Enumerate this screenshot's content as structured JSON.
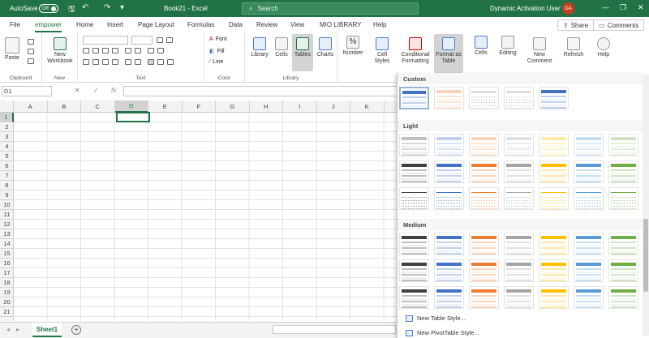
{
  "titlebar": {
    "autosave_label": "AutoSave",
    "autosave_state": "Off",
    "doc_title": "Book21 - Excel",
    "search_placeholder": "Search",
    "user_name": "Dynamic Activation User",
    "user_initials": "DA"
  },
  "tabs": [
    "File",
    "empower",
    "Home",
    "Insert",
    "Page Layout",
    "Formulas",
    "Data",
    "Review",
    "View",
    "MIO LIBRARY",
    "Help"
  ],
  "active_tab": "empower",
  "topbar": {
    "share": "Share",
    "comments": "Comments"
  },
  "ribbon": {
    "groups": {
      "clipboard": "Clipboard",
      "new": "New",
      "text": "Text",
      "color": "Color",
      "library": "Library"
    },
    "buttons": {
      "paste": "Paste",
      "new_workbook_1": "New",
      "new_workbook_2": "Workbook",
      "font": "Font",
      "fill": "Fill",
      "line": "Line",
      "library": "Library",
      "cells": "Cells",
      "tables": "Tables",
      "charts": "Charts",
      "number": "Number",
      "cell_styles_1": "Cell",
      "cell_styles_2": "Styles",
      "cond_format_1": "Conditional",
      "cond_format_2": "Formatting",
      "format_table_1": "Format as",
      "format_table_2": "Table",
      "cells2": "Cells",
      "editing": "Editing",
      "new_comment_1": "New",
      "new_comment_2": "Comment",
      "refresh": "Refresh",
      "help": "Help"
    }
  },
  "formula_bar": {
    "name_box": "D1",
    "fx": "fx"
  },
  "columns": [
    "A",
    "B",
    "C",
    "D",
    "E",
    "F",
    "G",
    "H",
    "I",
    "J",
    "K"
  ],
  "selected_column": "D",
  "rows": [
    "1",
    "2",
    "3",
    "4",
    "5",
    "6",
    "7",
    "8",
    "9",
    "10",
    "11",
    "12",
    "13",
    "14",
    "15",
    "16",
    "17",
    "18",
    "19",
    "20",
    "21"
  ],
  "selected_row": "1",
  "sheet": {
    "name": "Sheet1"
  },
  "gallery": {
    "sections": {
      "custom": "Custom",
      "light": "Light",
      "medium": "Medium"
    },
    "menu": {
      "new_table_style": "New Table Style...",
      "new_pivot_style": "New PivotTable Style..."
    },
    "colors": {
      "black": "#404040",
      "blue": "#4472c4",
      "orange": "#ed7d31",
      "gray": "#a5a5a5",
      "gold": "#ffc000",
      "lightblue": "#5b9bd5",
      "green": "#70ad47"
    }
  },
  "colors": {
    "accent": "#217346"
  }
}
